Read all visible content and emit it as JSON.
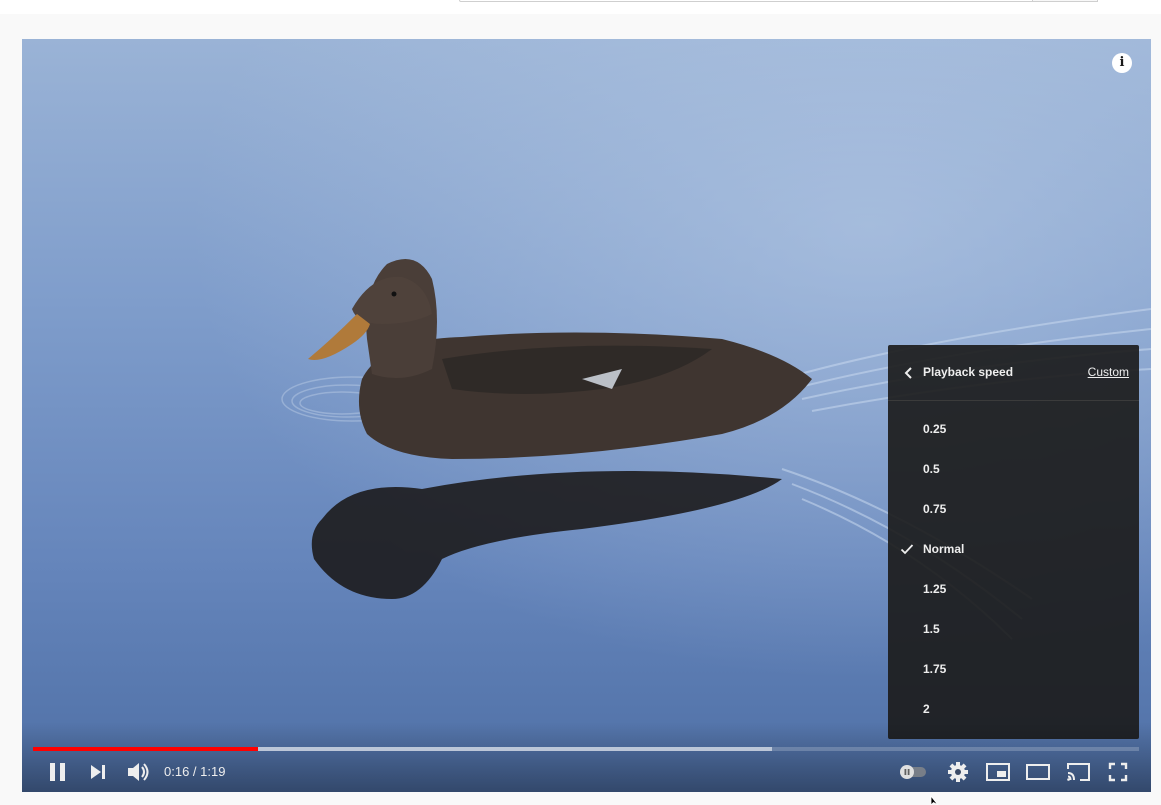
{
  "menu": {
    "title": "Playback speed",
    "custom_label": "Custom",
    "selected": "Normal",
    "speeds": [
      {
        "label": "0.25",
        "selected": false
      },
      {
        "label": "0.5",
        "selected": false
      },
      {
        "label": "0.75",
        "selected": false
      },
      {
        "label": "Normal",
        "selected": true
      },
      {
        "label": "1.25",
        "selected": false
      },
      {
        "label": "1.5",
        "selected": false
      },
      {
        "label": "1.75",
        "selected": false
      },
      {
        "label": "2",
        "selected": false
      }
    ]
  },
  "player": {
    "current_time": "0:16",
    "separator": " / ",
    "duration": "1:19",
    "played_fraction": 0.203,
    "loaded_fraction": 0.668,
    "info_glyph": "i",
    "autoplay_on": false,
    "accent_color": "#ff0000"
  },
  "icons": [
    "info-icon",
    "chevron-left-icon",
    "check-icon",
    "pause-icon",
    "next-icon",
    "volume-icon",
    "autoplay-toggle-icon",
    "gear-icon",
    "miniplayer-icon",
    "theater-icon",
    "cast-icon",
    "fullscreen-icon"
  ]
}
